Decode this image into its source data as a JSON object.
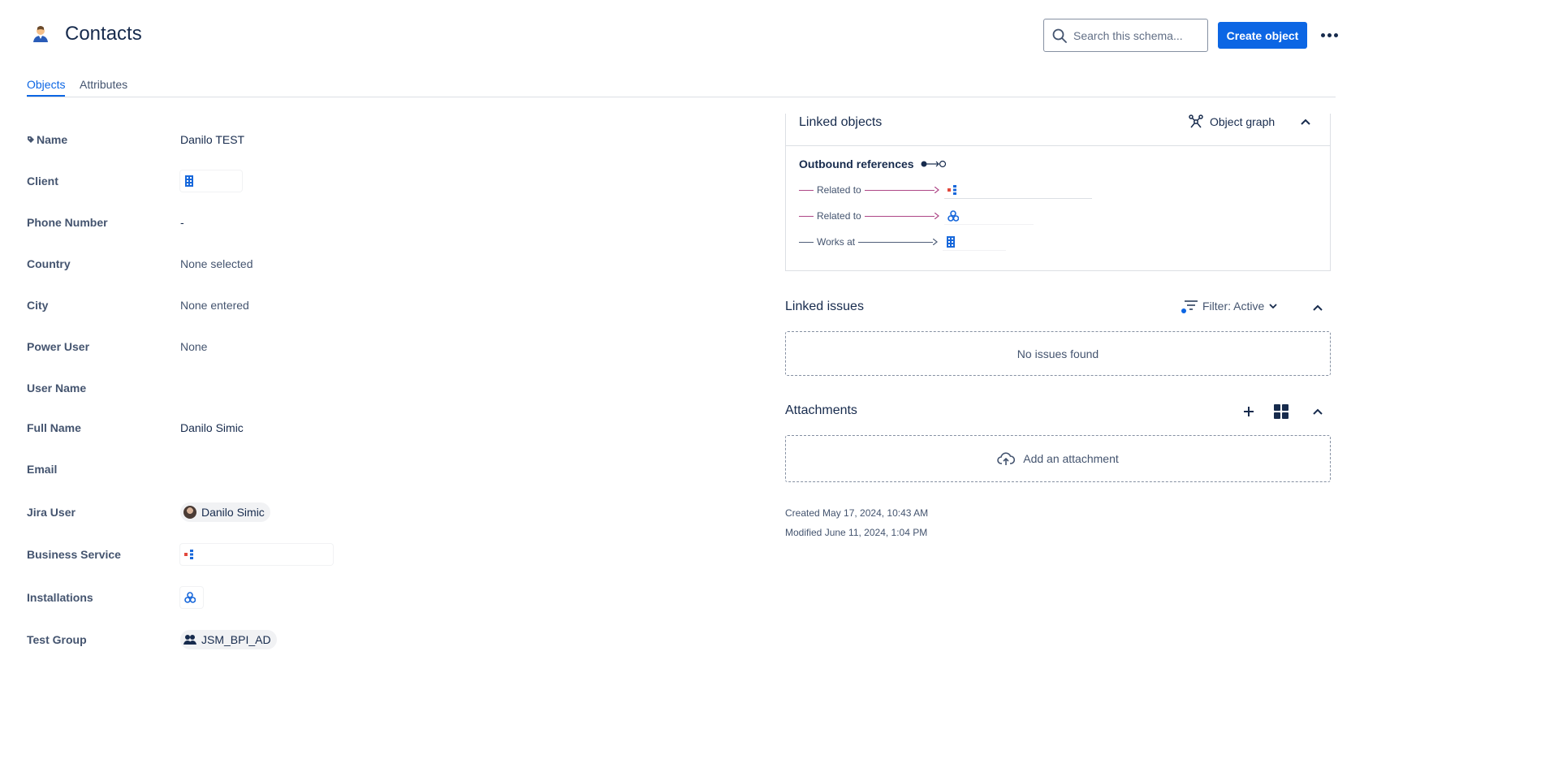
{
  "header": {
    "title": "Contacts",
    "schema_icon": "contact-person-icon",
    "search_placeholder": "Search this schema...",
    "create_label": "Create object",
    "more_icon": "more-horizontal-icon"
  },
  "tabs": [
    {
      "label": "Objects",
      "active": true
    },
    {
      "label": "Attributes",
      "active": false
    }
  ],
  "attributes": [
    {
      "label": "Name",
      "value": "Danilo TEST",
      "icon": "tag-icon"
    },
    {
      "label": "Client",
      "value": "",
      "ref_icon": "building-icon"
    },
    {
      "label": "Phone Number",
      "value": "-"
    },
    {
      "label": "Country",
      "value": "None selected"
    },
    {
      "label": "City",
      "value": "None entered"
    },
    {
      "label": "Power User",
      "value": "None"
    },
    {
      "label": "User Name",
      "value": ""
    },
    {
      "label": "Full Name",
      "value": "Danilo Simic"
    },
    {
      "label": "Email",
      "value": ""
    },
    {
      "label": "Jira User",
      "value": "Danilo Simic",
      "avatar": "user-avatar"
    },
    {
      "label": "Business Service",
      "value": "",
      "ref_icon": "service-icon"
    },
    {
      "label": "Installations",
      "value": "",
      "ref_icon": "installation-icon"
    },
    {
      "label": "Test Group",
      "value": "JSM_BPI_AD",
      "chip_icon": "group-icon"
    }
  ],
  "linked_objects": {
    "title": "Linked objects",
    "graph_label": "Object graph",
    "outbound_label": "Outbound references",
    "references": [
      {
        "label": "Related to",
        "color": "#ae4787",
        "target_icon": "service-icon"
      },
      {
        "label": "Related to",
        "color": "#ae4787",
        "target_icon": "installation-icon"
      },
      {
        "label": "Works at",
        "color": "#505f79",
        "target_icon": "building-icon"
      }
    ]
  },
  "linked_issues": {
    "title": "Linked issues",
    "filter_label": "Filter: Active",
    "empty_text": "No issues found"
  },
  "attachments": {
    "title": "Attachments",
    "add_label": "Add an attachment"
  },
  "meta": {
    "created": "Created May 17, 2024, 10:43 AM",
    "modified": "Modified June 11, 2024, 1:04 PM"
  },
  "colors": {
    "brand": "#0c66e4",
    "reference_pink": "#ae4787",
    "reference_gray": "#505f79"
  }
}
